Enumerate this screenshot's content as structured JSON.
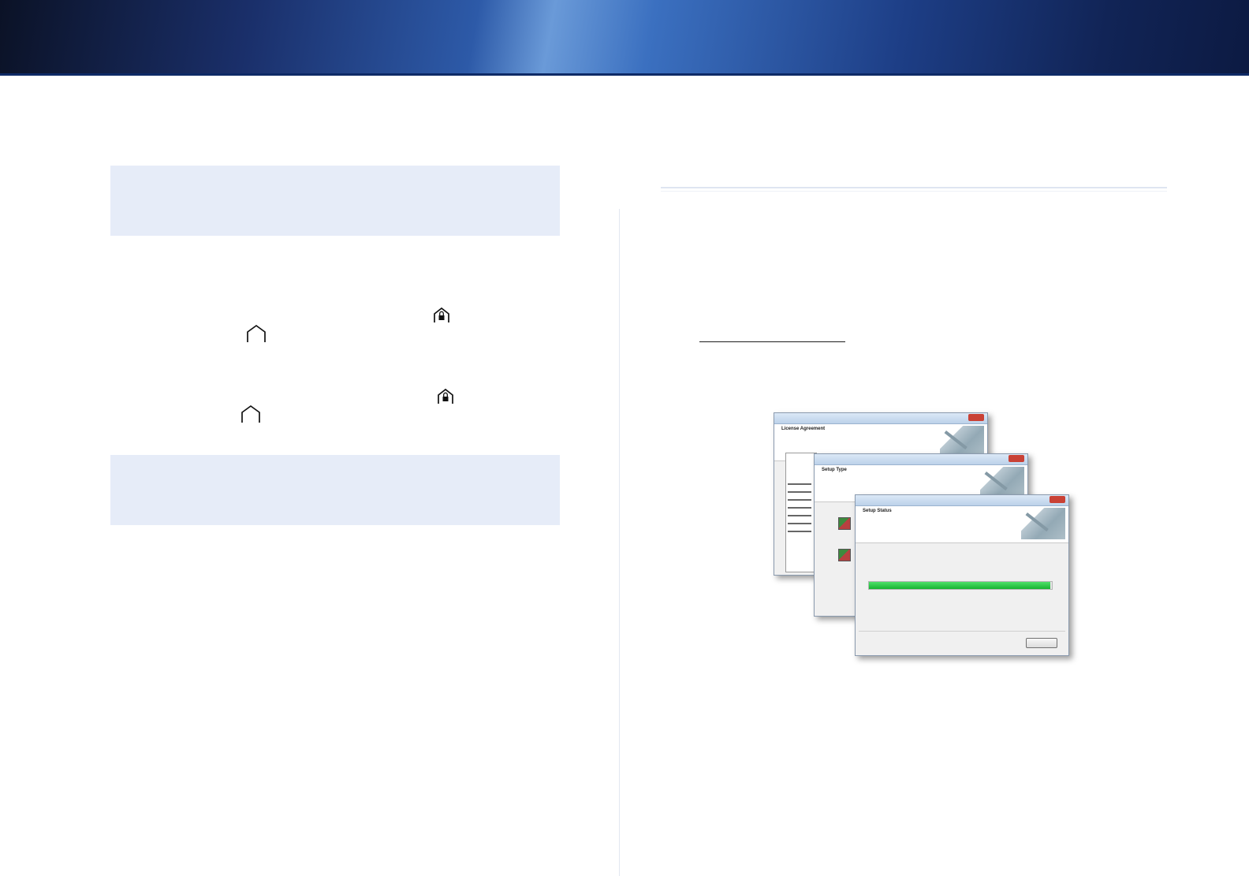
{
  "icons": {
    "icon_1": "home-lock-icon",
    "icon_2": "home-outline-icon",
    "icon_3": "home-lock-icon",
    "icon_4": "home-outline-icon"
  },
  "installer": {
    "dialog_license": {
      "heading": "License Agreement"
    },
    "dialog_setup_type": {
      "heading": "Setup Type"
    },
    "dialog_status": {
      "heading": "Setup Status"
    },
    "progress_fraction": 0.99
  },
  "colors": {
    "callout_bg": "#e6ecf8",
    "progress_green": "#17b431"
  }
}
